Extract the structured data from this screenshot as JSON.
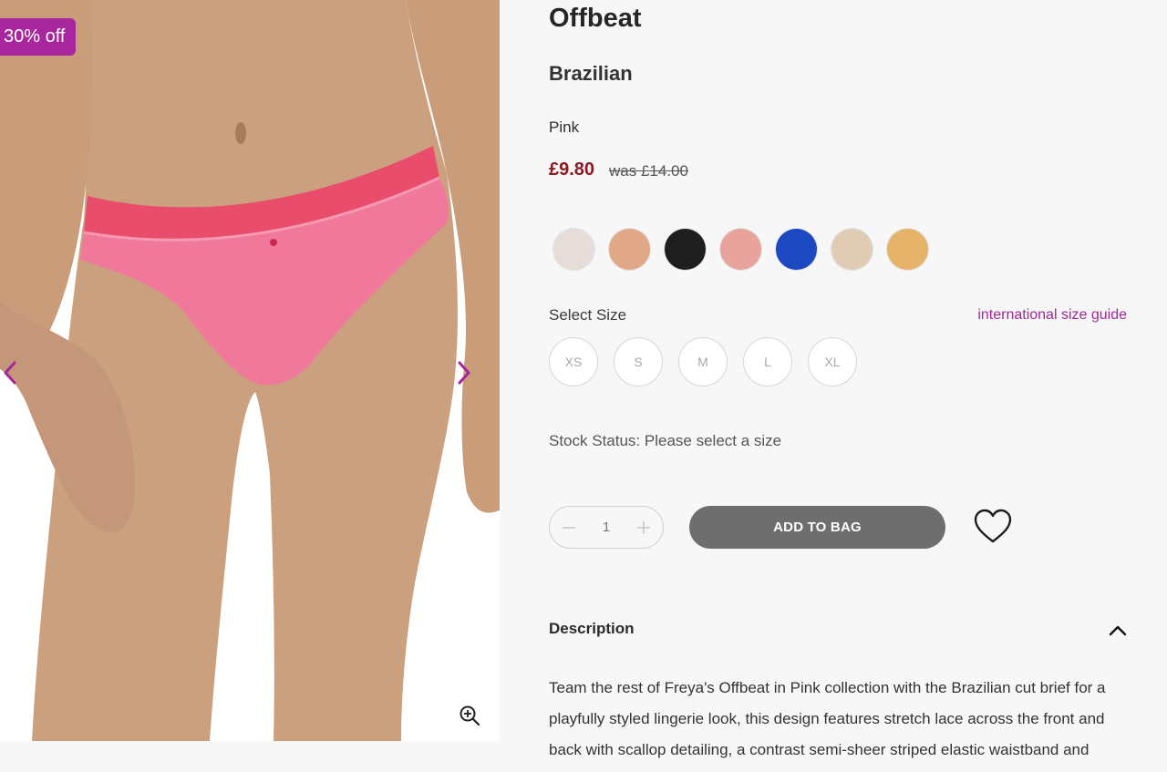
{
  "colors": {
    "accent": "#a5269b",
    "badge_bg": "#a8279e",
    "price": "#8b1a23",
    "button_bg": "#6e6e6e"
  },
  "gallery": {
    "badge": "30% off",
    "prev_icon": "chevron-left-icon",
    "next_icon": "chevron-right-icon",
    "zoom_icon": "zoom-in-icon"
  },
  "product": {
    "brand": "Offbeat",
    "style": "Brazilian",
    "colour": "Pink",
    "price": "£9.80",
    "was_price": "was £14.00"
  },
  "swatches": [
    {
      "name": "white-lace",
      "color": "#e6dcd8"
    },
    {
      "name": "nude-lace",
      "color": "#e0a886"
    },
    {
      "name": "black-lace",
      "color": "#1e1e1e"
    },
    {
      "name": "pink-lace",
      "color": "#e7a39c"
    },
    {
      "name": "blue-lace",
      "color": "#1c48c2"
    },
    {
      "name": "cream-lace",
      "color": "#e0ccb4"
    },
    {
      "name": "gold-lace",
      "color": "#e5b46a"
    }
  ],
  "size": {
    "label": "Select Size",
    "guide_link": "international size guide",
    "options": [
      "XS",
      "S",
      "M",
      "L",
      "XL"
    ]
  },
  "stock": {
    "text": "Stock Status: Please select a size"
  },
  "quantity": {
    "value": "1",
    "minus_icon": "minus-icon",
    "plus_icon": "plus-icon"
  },
  "actions": {
    "add_to_bag": "ADD TO BAG",
    "wishlist_icon": "heart-icon"
  },
  "description": {
    "title": "Description",
    "toggle_icon": "chevron-up-icon",
    "lines": [
      "Team the rest of Freya's Offbeat in Pink collection with the Brazilian cut brief for a",
      "playfully styled lingerie look, this design features stretch lace across the front and",
      "back with scallop detailing, a contrast semi-sheer striped elastic waistband and"
    ]
  }
}
